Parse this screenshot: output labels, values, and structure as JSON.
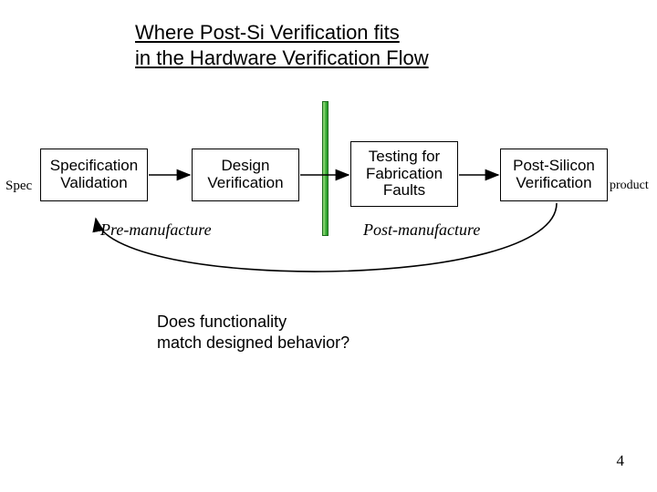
{
  "title_line1": "Where Post-Si Verification fits",
  "title_line2": "in the Hardware Verification Flow",
  "labels": {
    "spec": "Spec",
    "product": "product"
  },
  "boxes": {
    "b1": "Specification Validation",
    "b2": "Design Verification",
    "b3": "Testing for Fabrication Faults",
    "b4": "Post-Silicon Verification"
  },
  "phases": {
    "pre": "Pre-manufacture",
    "post": "Post-manufacture"
  },
  "question_line1": "Does functionality",
  "question_line2": "match designed behavior?",
  "page_number": "4",
  "colors": {
    "divider_light": "#7ecf6a",
    "divider_dark": "#2fa32f"
  }
}
